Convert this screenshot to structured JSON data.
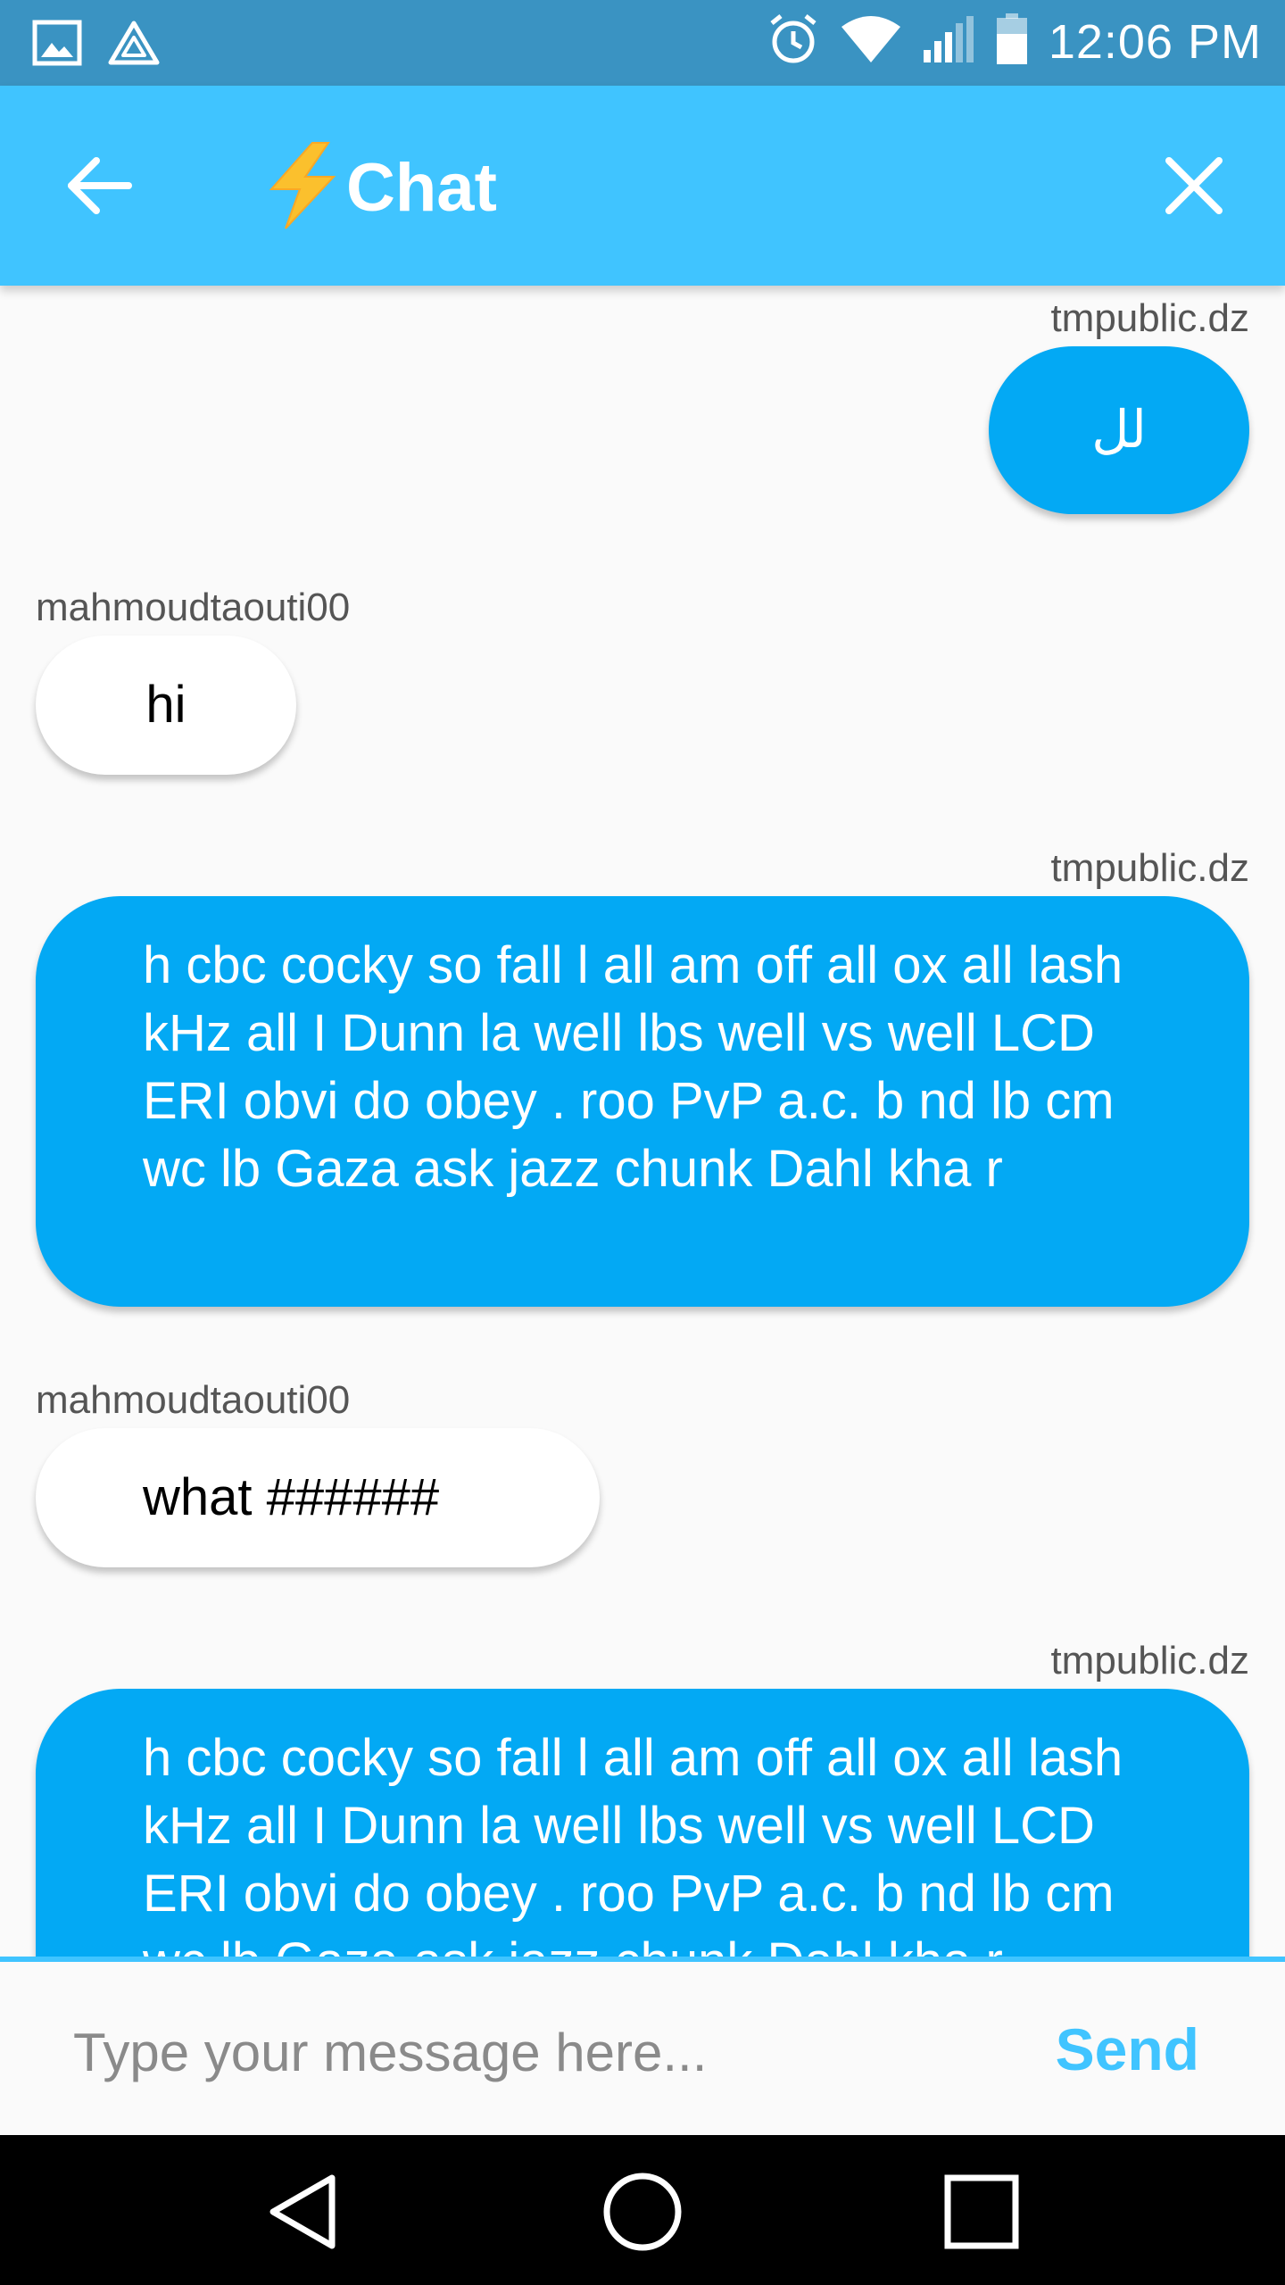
{
  "status_bar": {
    "time": "12:06 PM",
    "icons": [
      "image-icon",
      "drive-icon",
      "alarm-icon",
      "wifi-icon",
      "signal-icon",
      "battery-icon"
    ]
  },
  "app_bar": {
    "title": "Chat",
    "emoji": "⚡",
    "back_icon": "arrow-left-icon",
    "close_icon": "close-icon",
    "color": "#40c4ff"
  },
  "messages": [
    {
      "sender": "tmpublic.dz",
      "text": "لل",
      "direction": "outgoing"
    },
    {
      "sender": "mahmoudtaouti00",
      "text": "hi",
      "direction": "incoming"
    },
    {
      "sender": "tmpublic.dz",
      "text": "h cbc cocky so fall l all am off all ox all lash kHz all I Dunn la well lbs well vs well LCD ERI obvi do obey . roo PvP a.c. b nd lb cm wc lb Gaza ask jazz chunk Dahl kha r",
      "direction": "outgoing"
    },
    {
      "sender": "mahmoudtaouti00",
      "text": "what ######",
      "direction": "incoming"
    },
    {
      "sender": "tmpublic.dz",
      "text": "h cbc cocky so fall l all am off all ox all lash kHz all I Dunn la well lbs well vs well LCD ERI obvi do obey . roo PvP a.c. b nd lb cm wc lb Gaza ask jazz chunk Dahl kha r",
      "direction": "outgoing"
    }
  ],
  "composer": {
    "placeholder": "Type your message here...",
    "value": "",
    "send_label": "Send"
  },
  "nav_bar": {
    "icons": [
      "back-triangle-icon",
      "home-circle-icon",
      "recents-square-icon"
    ]
  },
  "colors": {
    "outgoing_bubble": "#03a9f4",
    "incoming_bubble": "#ffffff",
    "accent": "#40c4ff"
  }
}
